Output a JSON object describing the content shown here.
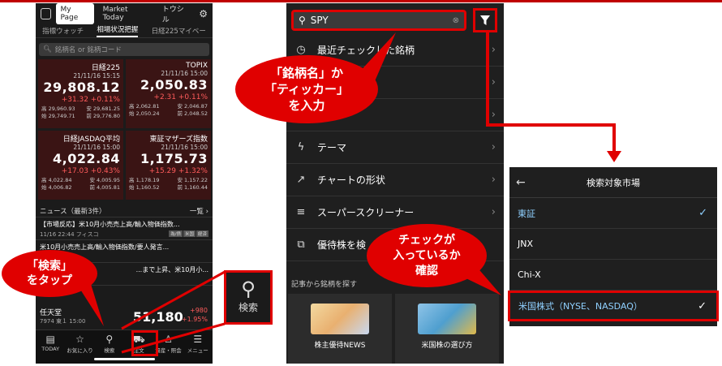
{
  "colors": {
    "accent_red": "#e00000",
    "up_red": "#ff5b5b",
    "dark_bg": "#1b1b1b",
    "card_bg": "#3a1414",
    "selected_blue": "#8fd0ff"
  },
  "phone1": {
    "tabs": [
      {
        "label": "My Page",
        "active": true
      },
      {
        "label": "Market Today",
        "active": false
      },
      {
        "label": "トウシル",
        "active": false
      }
    ],
    "subtabs": [
      "指標ウォッチ",
      "相場状況把握",
      "日経225マイベー"
    ],
    "search_placeholder": "銘柄名 or 銘柄コード",
    "cards": [
      {
        "name": "日経225",
        "datetime": "21/11/16 15:15",
        "value": "29,808.12",
        "change": "+31.32 +0.11%",
        "hl1a": "高 29,960.93",
        "hl1b": "安 29,681.25",
        "hl2a": "始 29,749.71",
        "hl2b": "前 29,776.80"
      },
      {
        "name": "TOPIX",
        "datetime": "21/11/16 15:00",
        "value": "2,050.83",
        "change": "+2.31 +0.11%",
        "hl1a": "高 2,062.81",
        "hl1b": "安 2,046.87",
        "hl2a": "始 2,050.24",
        "hl2b": "前 2,048.52"
      },
      {
        "name": "日経JASDAQ平均",
        "datetime": "21/11/16 15:00",
        "value": "4,022.84",
        "change": "+17.03 +0.43%",
        "hl1a": "高 4,022.84",
        "hl1b": "安 4,005.95",
        "hl2a": "始 4,006.82",
        "hl2b": "前 4,005.81"
      },
      {
        "name": "東証マザーズ指数",
        "datetime": "21/11/16 15:00",
        "value": "1,175.73",
        "change": "+15.29 +1.32%",
        "hl1a": "高 1,178.19",
        "hl1b": "安 1,157.22",
        "hl2a": "始 1,160.52",
        "hl2b": "前 1,160.44"
      }
    ],
    "news_header": "ニュース（最新3件）",
    "news_more": "一覧 ›",
    "news": [
      {
        "title": "【市場反応】米10月小売売上高/輸入物価指数...",
        "time": "11/16 22:44 フィスコ"
      },
      {
        "title": "米10月小売売上高/輸入物価指数/要人発言...",
        "time": ""
      },
      {
        "title": "...まで上昇、米10月小...",
        "time": ""
      }
    ],
    "stock": {
      "name": "任天堂",
      "code": "7974 東１",
      "time": "15:00",
      "price": "51,180",
      "diff": "+980",
      "pct": "+1.95%"
    },
    "nav": [
      {
        "label": "TODAY",
        "icon": "document-icon"
      },
      {
        "label": "お気に入り",
        "icon": "star-icon"
      },
      {
        "label": "検索",
        "icon": "search-icon"
      },
      {
        "label": "注文",
        "icon": "cart-icon"
      },
      {
        "label": "資産・照会",
        "icon": "person-icon"
      },
      {
        "label": "メニュー",
        "icon": "menu-icon"
      }
    ]
  },
  "big_search_label": "検索",
  "phone2": {
    "search_value": "SPY",
    "menu": [
      {
        "label": "最近チェックした銘柄",
        "icon": "clock-icon"
      },
      {
        "label": "",
        "icon": ""
      },
      {
        "label": "",
        "icon": ""
      },
      {
        "label": "テーマ",
        "icon": "lightning-icon"
      },
      {
        "label": "チャートの形状",
        "icon": "chart-icon"
      },
      {
        "label": "スーパースクリーナー",
        "icon": "sliders-icon"
      },
      {
        "label": "優待株を検",
        "icon": "doc-search-icon"
      }
    ],
    "section_title": "記事から銘柄を探す",
    "tiles": [
      {
        "label": "株主優待NEWS"
      },
      {
        "label": "米国株の選び方"
      }
    ]
  },
  "market_panel": {
    "title": "検索対象市場",
    "rows": [
      {
        "label": "東証",
        "checked": true
      },
      {
        "label": "JNX",
        "checked": false
      },
      {
        "label": "Chi-X",
        "checked": false
      },
      {
        "label": "米国株式（NYSE、NASDAQ）",
        "checked": true
      }
    ]
  },
  "callouts": {
    "tap_search": [
      "「検索」",
      "をタップ"
    ],
    "enter_name": [
      "「銘柄名」か",
      "「ティッカー」",
      "を入力"
    ],
    "check_confirm": [
      "チェックが",
      "入っているか",
      "確認"
    ]
  }
}
